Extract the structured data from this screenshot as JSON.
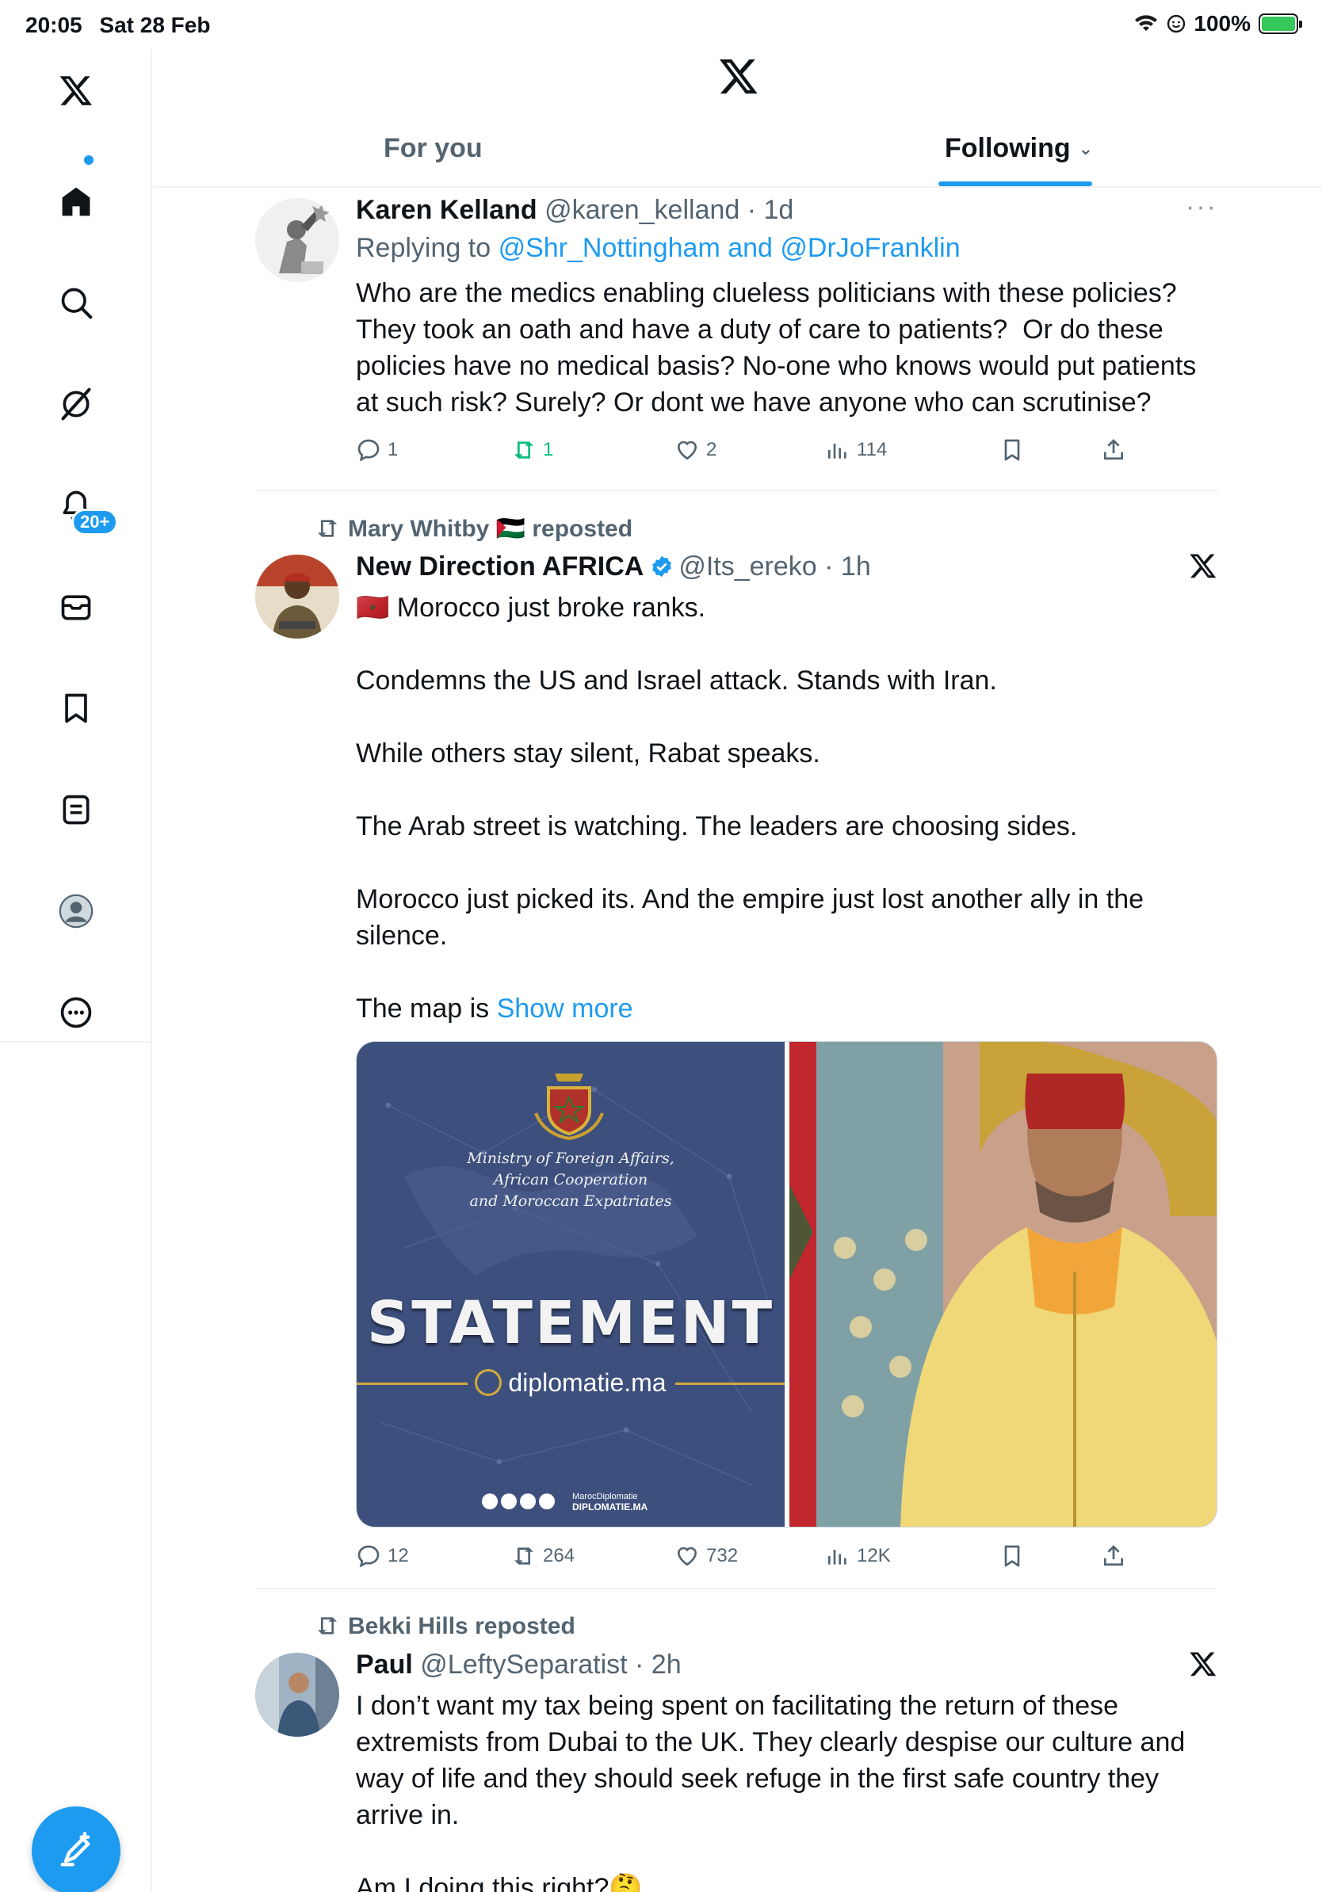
{
  "status_bar": {
    "time": "20:05",
    "date": "Sat 28 Feb",
    "battery": "100%"
  },
  "sidebar": {
    "items": [
      "x-logo",
      "home",
      "explore",
      "grok",
      "notifications",
      "messages",
      "bookmarks",
      "lists",
      "profile",
      "more"
    ],
    "notifications_badge": "20+"
  },
  "header": {
    "tabs": [
      {
        "label": "For you"
      },
      {
        "label": "Following"
      }
    ],
    "active_tab": "Following"
  },
  "tweets": [
    {
      "name": "Karen Kelland",
      "handle": "@karen_kelland",
      "time": "1d",
      "replying_prefix": "Replying to",
      "replying_to": "@Shr_Nottingham and @DrJoFranklin",
      "text": "Who are the medics enabling clueless politicians with these policies? They took an oath and have a duty of care to patients?  Or do these policies have no medical basis? No-one who knows would put patients at such risk? Surely? Or dont we have anyone who can scrutinise?",
      "stats": {
        "replies": "1",
        "reposts": "1",
        "likes": "2",
        "views": "114"
      }
    },
    {
      "reposted_by": "Mary Whitby 🇵🇸 reposted",
      "name": "New Direction AFRICA",
      "handle": "@Its_ereko",
      "time": "1h",
      "text": "🇲🇦 Morocco just broke ranks.\n\nCondemns the US and Israel attack. Stands with Iran.\n\nWhile others stay silent, Rabat speaks.\n\nThe Arab street is watching. The leaders are choosing sides.\n\nMorocco just picked its. And the empire just lost another ally in the silence.\n\nThe map is ",
      "show_more": "Show more",
      "media": {
        "ministry": "Ministry of Foreign Affairs,\nAfrican Cooperation\nand Moroccan Expatriates",
        "headline": "STATEMENT",
        "site": "diplomatie.ma",
        "footer_small": "MarocDiplomatie",
        "footer": "DIPLOMATIE.MA"
      },
      "stats": {
        "replies": "12",
        "reposts": "264",
        "likes": "732",
        "views": "12K"
      }
    },
    {
      "reposted_by": "Bekki Hills reposted",
      "name": "Paul",
      "handle": "@LeftySeparatist",
      "time": "2h",
      "text": "I don’t want my tax being spent on facilitating the return of these extremists from Dubai to the UK. They clearly despise our culture and way of life and they should seek refuge in the first safe country they arrive in.\n\nAm I doing this right?🤔"
    }
  ],
  "colors": {
    "accent": "#1d9bf0",
    "repost_green": "#00ba7c",
    "secondary_text": "#536471"
  }
}
